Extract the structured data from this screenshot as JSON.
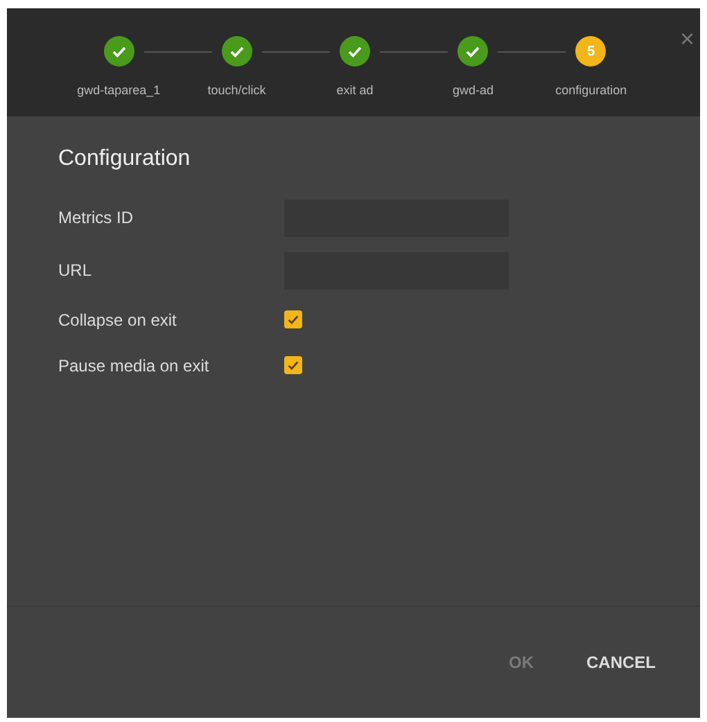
{
  "steps": [
    {
      "label": "gwd-taparea_1",
      "completed": true
    },
    {
      "label": "touch/click",
      "completed": true
    },
    {
      "label": "exit ad",
      "completed": true
    },
    {
      "label": "gwd-ad",
      "completed": true
    },
    {
      "label": "configuration",
      "completed": false,
      "number": "5"
    }
  ],
  "close": "×",
  "title": "Configuration",
  "fields": [
    {
      "kind": "text",
      "label": "Metrics ID"
    },
    {
      "kind": "text",
      "label": "URL"
    },
    {
      "kind": "checkbox",
      "label": "Collapse on exit",
      "checked": true
    },
    {
      "kind": "checkbox",
      "label": "Pause media on exit",
      "checked": true
    }
  ],
  "buttons": [
    {
      "label": "OK",
      "disabled": true
    },
    {
      "label": "CANCEL",
      "disabled": false
    }
  ]
}
